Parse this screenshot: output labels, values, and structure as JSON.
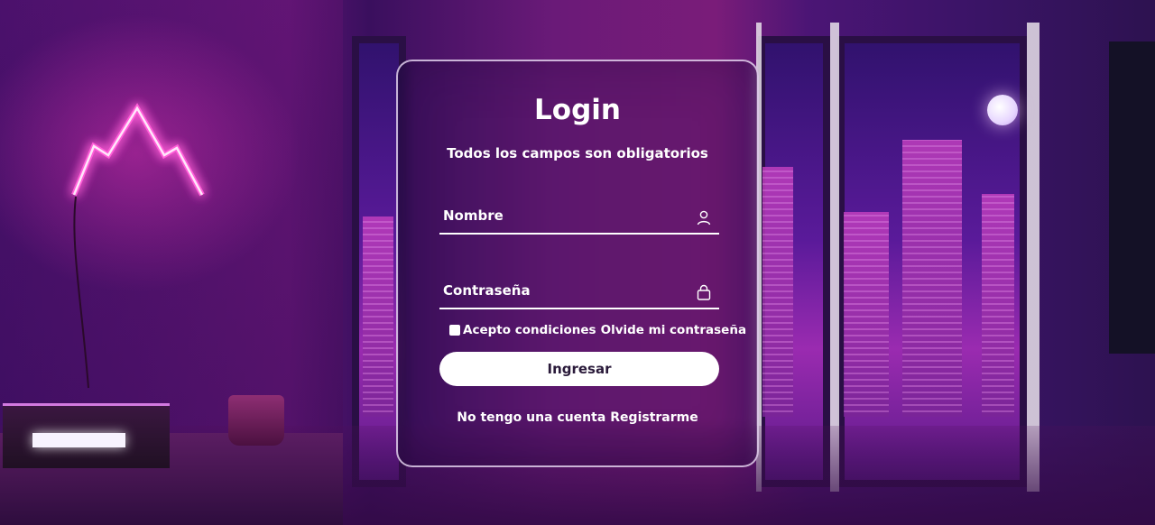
{
  "login": {
    "title": "Login",
    "subtitle": "Todos los campos son obligatorios",
    "name_field": {
      "placeholder": "Nombre",
      "value": "",
      "icon": "user-icon"
    },
    "password_field": {
      "placeholder": "Contraseña",
      "value": "",
      "icon": "lock-icon"
    },
    "accept_terms_label": "Acepto condiciones",
    "forgot_password_link": "Olvide mi contraseña",
    "submit_label": "Ingresar",
    "no_account_text": "No tengo una cuenta",
    "register_link": "Registrarme"
  },
  "colors": {
    "accent": "#ffffff",
    "background_purple": "#3c1068",
    "neon_pink": "#ff5fd8"
  }
}
